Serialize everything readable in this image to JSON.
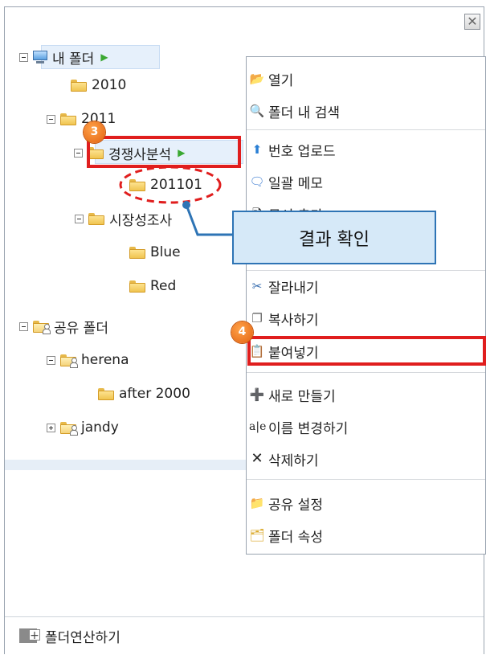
{
  "window": {
    "close_glyph": "✕"
  },
  "tree": {
    "root": "내 폴더",
    "n2010": "2010",
    "n2011": "2011",
    "competitor": "경쟁사분석",
    "n201101": "201101",
    "market": "시장성조사",
    "blue": "Blue",
    "red": "Red",
    "shared": "공유 폴더",
    "herena": "herena",
    "after2000": "after 2000",
    "jandy": "jandy"
  },
  "context_menu": {
    "items": [
      {
        "label": "열기",
        "icon": "folder-open-icon"
      },
      {
        "label": "폴더 내 검색",
        "icon": "folder-search-icon"
      },
      {
        "label": "번호 업로드",
        "icon": "upload-icon"
      },
      {
        "label": "일괄 메모",
        "icon": "memo-icon"
      },
      {
        "label": "문서 추가",
        "icon": "document-add-icon"
      },
      {
        "label": "잘라내기",
        "icon": "scissors-icon"
      },
      {
        "label": "복사하기",
        "icon": "copy-icon"
      },
      {
        "label": "붙여넣기",
        "icon": "paste-icon"
      },
      {
        "label": "새로 만들기",
        "icon": "new-folder-icon"
      },
      {
        "label": "이름 변경하기",
        "icon": "rename-icon"
      },
      {
        "label": "삭제하기",
        "icon": "delete-icon"
      },
      {
        "label": "공유 설정",
        "icon": "share-settings-icon"
      },
      {
        "label": "폴더 속성",
        "icon": "folder-properties-icon"
      }
    ]
  },
  "annotations": {
    "step3": "3",
    "step4": "4",
    "callout": "결과 확인",
    "red_color": "#e01e1e",
    "badge_color": "#f07a1e"
  },
  "footer": {
    "label": "폴더연산하기"
  }
}
